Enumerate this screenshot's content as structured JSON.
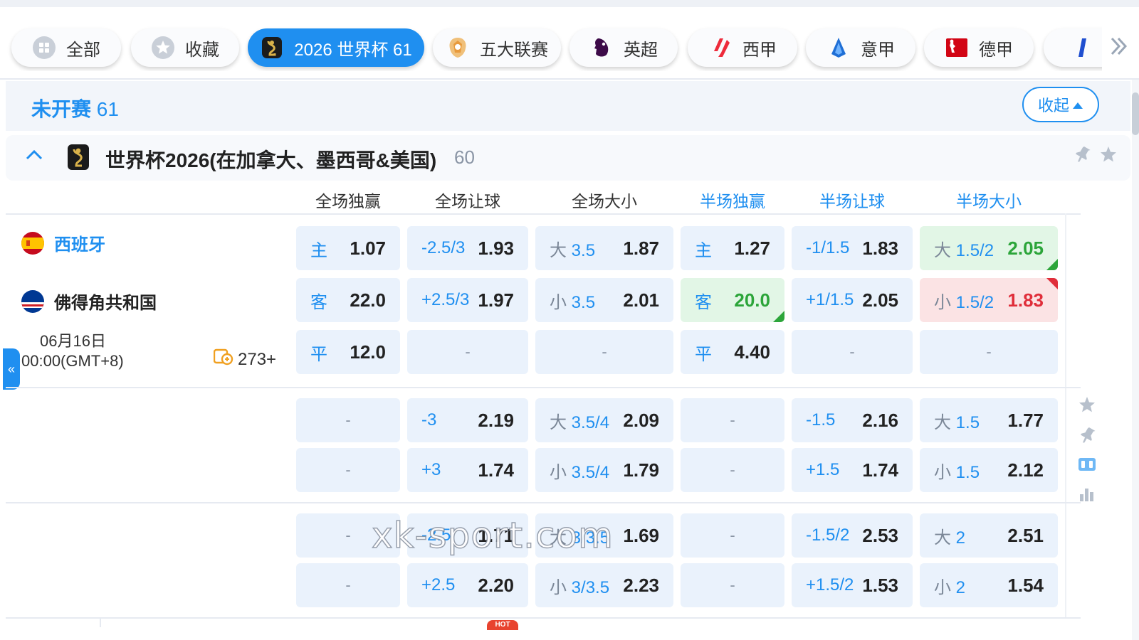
{
  "tabs": [
    {
      "label": "全部",
      "icon": "grid-icon"
    },
    {
      "label": "收藏",
      "icon": "star-icon"
    },
    {
      "label": "2026 世界杯 61",
      "icon": "world-cup-icon",
      "active": true
    },
    {
      "label": "五大联赛",
      "icon": "five-leagues-icon"
    },
    {
      "label": "英超",
      "icon": "premier-league-icon"
    },
    {
      "label": "西甲",
      "icon": "laliga-icon"
    },
    {
      "label": "意甲",
      "icon": "serie-a-icon"
    },
    {
      "label": "德甲",
      "icon": "bundesliga-icon"
    }
  ],
  "tabs_more_icon": "double-chevron-right-icon",
  "section": {
    "title": "未开赛",
    "count": "61",
    "collapse_label": "收起"
  },
  "league": {
    "name": "世界杯2026(在加拿大、墨西哥&美国)",
    "count": "60"
  },
  "columns": [
    "全场独赢",
    "全场让球",
    "全场大小",
    "半场独赢",
    "半场让球",
    "半场大小"
  ],
  "match": {
    "home": "西班牙",
    "away": "佛得角共和国",
    "date": "06月16日",
    "time": "00:00(GMT+8)",
    "markets": "273+"
  },
  "odds_rows": [
    [
      {
        "lbl": "主",
        "odd": "1.07"
      },
      {
        "lbl": "-2.5/3",
        "odd": "1.93"
      },
      {
        "pre": "大",
        "lbl": "3.5",
        "odd": "1.87"
      },
      {
        "lbl": "主",
        "odd": "1.27"
      },
      {
        "lbl": "-1/1.5",
        "odd": "1.83"
      },
      {
        "pre": "大",
        "lbl": "1.5/2",
        "odd": "2.05",
        "trend": "up"
      }
    ],
    [
      {
        "lbl": "客",
        "odd": "22.0"
      },
      {
        "lbl": "+2.5/3",
        "odd": "1.97"
      },
      {
        "pre": "小",
        "lbl": "3.5",
        "odd": "2.01"
      },
      {
        "lbl": "客",
        "odd": "20.0",
        "trend": "up"
      },
      {
        "lbl": "+1/1.5",
        "odd": "2.05"
      },
      {
        "pre": "小",
        "lbl": "1.5/2",
        "odd": "1.83",
        "trend": "down"
      }
    ],
    [
      {
        "lbl": "平",
        "odd": "12.0"
      },
      {
        "empty": "-"
      },
      {
        "empty": "-"
      },
      {
        "lbl": "平",
        "odd": "4.40"
      },
      {
        "empty": "-"
      },
      {
        "empty": "-"
      }
    ],
    [
      {
        "empty": "-"
      },
      {
        "lbl": "-3",
        "odd": "2.19"
      },
      {
        "pre": "大",
        "lbl": "3.5/4",
        "odd": "2.09"
      },
      {
        "empty": "-"
      },
      {
        "lbl": "-1.5",
        "odd": "2.16"
      },
      {
        "pre": "大",
        "lbl": "1.5",
        "odd": "1.77"
      }
    ],
    [
      {
        "empty": "-"
      },
      {
        "lbl": "+3",
        "odd": "1.74"
      },
      {
        "pre": "小",
        "lbl": "3.5/4",
        "odd": "1.79"
      },
      {
        "empty": "-"
      },
      {
        "lbl": "+1.5",
        "odd": "1.74"
      },
      {
        "pre": "小",
        "lbl": "1.5",
        "odd": "2.12"
      }
    ],
    [
      {
        "empty": "-"
      },
      {
        "lbl": "-2.5",
        "odd": "1.71"
      },
      {
        "pre": "大",
        "lbl": "3/3.5",
        "odd": "1.69"
      },
      {
        "empty": "-"
      },
      {
        "lbl": "-1.5/2",
        "odd": "2.53"
      },
      {
        "pre": "大",
        "lbl": "2",
        "odd": "2.51"
      }
    ],
    [
      {
        "empty": "-"
      },
      {
        "lbl": "+2.5",
        "odd": "2.20"
      },
      {
        "pre": "小",
        "lbl": "3/3.5",
        "odd": "2.23"
      },
      {
        "empty": "-"
      },
      {
        "lbl": "+1.5/2",
        "odd": "1.53"
      },
      {
        "pre": "小",
        "lbl": "2",
        "odd": "1.54"
      }
    ]
  ],
  "watermark": "xk-sport.com",
  "hot_badge": "HOT",
  "colors": {
    "accent": "#1f8ff0",
    "cell_bg": "#eaf2fc",
    "up": "#2ca53a",
    "down": "#e02e3a"
  }
}
